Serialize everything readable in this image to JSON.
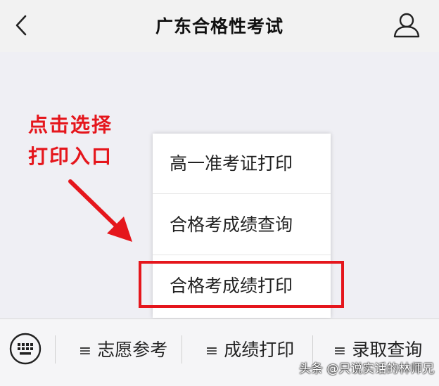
{
  "header": {
    "title": "广东合格性考试",
    "back_icon": "chevron-left-icon",
    "profile_icon": "user-icon"
  },
  "annotation": {
    "line1": "点击选择",
    "line2": "打印入口",
    "color": "#e5161c"
  },
  "popup_menu": {
    "items": [
      {
        "label": "高一准考证打印"
      },
      {
        "label": "合格考成绩查询"
      },
      {
        "label": "合格考成绩打印"
      }
    ],
    "highlighted_index": 2,
    "highlight_color": "#e5161c"
  },
  "bottom_bar": {
    "keyboard_icon": "keyboard-icon",
    "tabs": [
      {
        "glyph": "≡",
        "label": "志愿参考"
      },
      {
        "glyph": "≡",
        "label": "成绩打印"
      },
      {
        "glyph": "≡",
        "label": "录取查询"
      }
    ]
  },
  "watermark": {
    "text": "头条 @只说实话的林师兄"
  }
}
